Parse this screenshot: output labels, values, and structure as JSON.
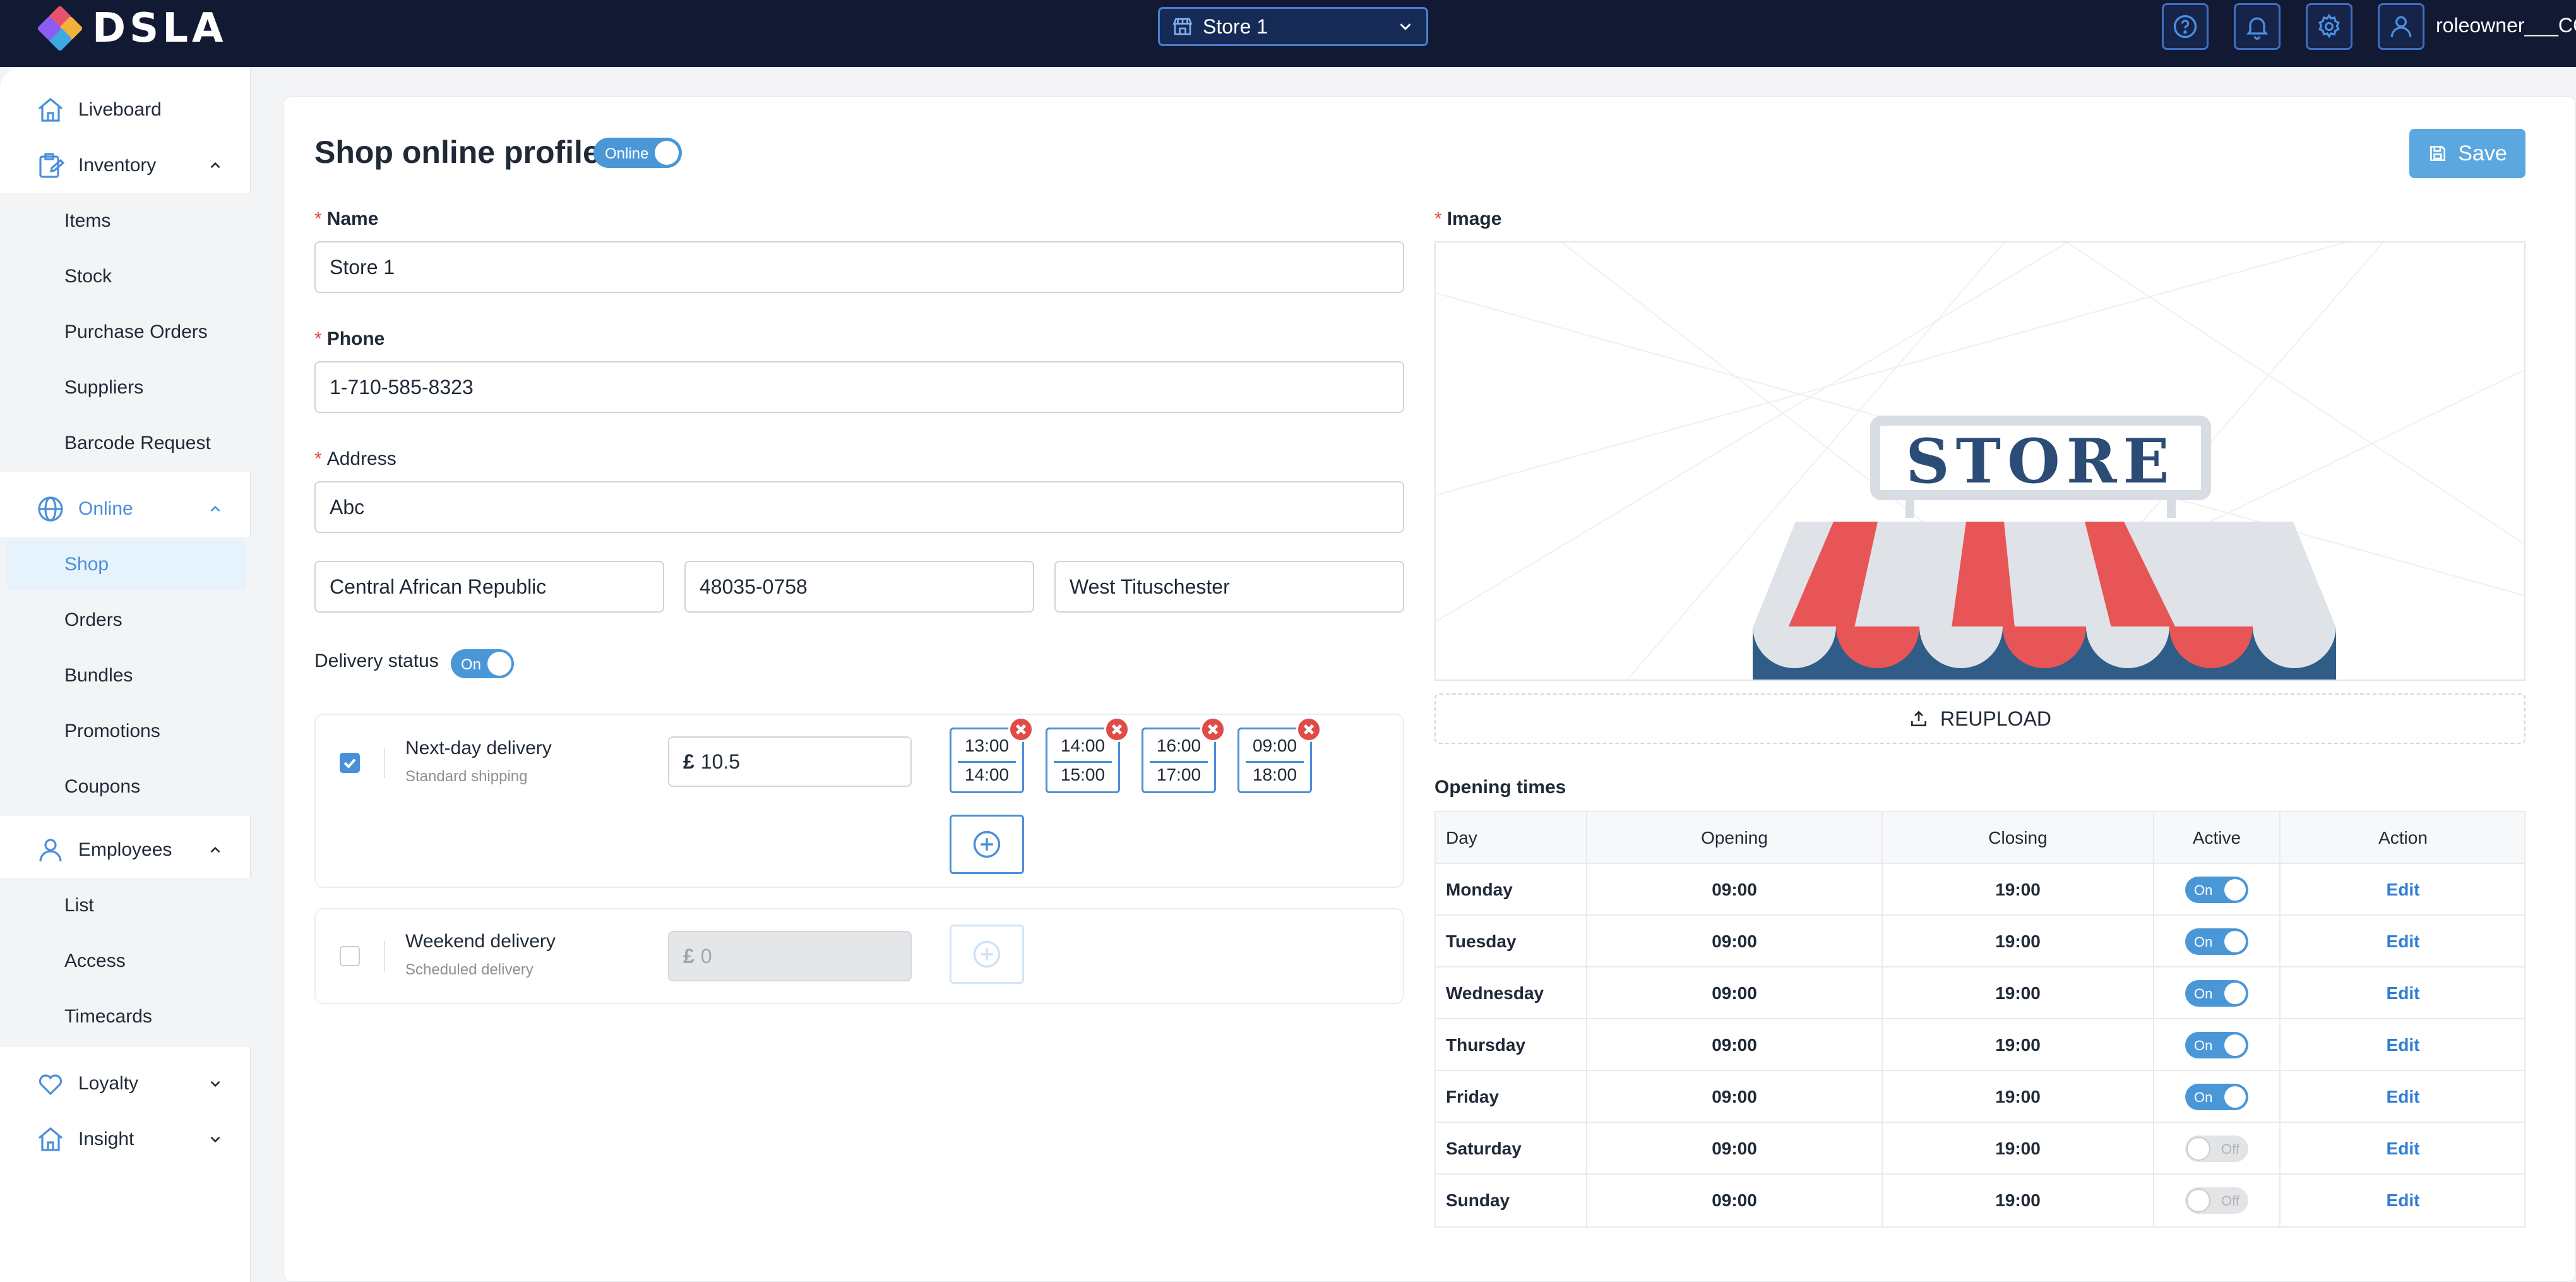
{
  "app": {
    "brand": "DSLA",
    "store_selector": "Store 1",
    "username": "roleowner___CC"
  },
  "colors": {
    "topbar": "#121a33",
    "accent": "#4a90d9",
    "save_button": "#5ca7e0",
    "danger": "#e04a48"
  },
  "icons": {
    "help": "help-icon",
    "notifications": "bell-icon",
    "settings": "gear-icon",
    "user": "user-icon"
  },
  "sidebar": {
    "items": [
      {
        "label": "Liveboard",
        "icon": "home-icon"
      },
      {
        "label": "Inventory",
        "icon": "inventory-icon",
        "expanded": true,
        "children": [
          "Items",
          "Stock",
          "Purchase Orders",
          "Suppliers",
          "Barcode Request"
        ]
      },
      {
        "label": "Online",
        "icon": "globe-icon",
        "expanded": true,
        "children": [
          "Shop",
          "Orders",
          "Bundles",
          "Promotions",
          "Coupons"
        ],
        "active_child": "Shop"
      },
      {
        "label": "Employees",
        "icon": "user-icon",
        "expanded": true,
        "children": [
          "List",
          "Access",
          "Timecards"
        ]
      },
      {
        "label": "Loyalty",
        "icon": "heart-icon",
        "expanded": false
      },
      {
        "label": "Insight",
        "icon": "home-icon",
        "expanded": false
      }
    ]
  },
  "page": {
    "title": "Shop online profile",
    "status_toggle": {
      "label": "Online",
      "on": true
    },
    "save_label": "Save"
  },
  "form": {
    "name_label": "Name",
    "name_value": "Store 1",
    "phone_label": "Phone",
    "phone_value": "1-710-585-8323",
    "address_label": "Address",
    "address_value": "Abc",
    "country_value": "Central African Republic",
    "postcode_value": "48035-0758",
    "city_value": "West Tituschester",
    "delivery_status_label": "Delivery status",
    "delivery_status_toggle": {
      "label": "On",
      "on": true
    }
  },
  "delivery": [
    {
      "title": "Next-day delivery",
      "subtitle": "Standard shipping",
      "checked": true,
      "currency": "£",
      "price": "10.5",
      "slots": [
        {
          "from": "13:00",
          "to": "14:00"
        },
        {
          "from": "14:00",
          "to": "15:00"
        },
        {
          "from": "16:00",
          "to": "17:00"
        },
        {
          "from": "09:00",
          "to": "18:00"
        }
      ]
    },
    {
      "title": "Weekend delivery",
      "subtitle": "Scheduled delivery",
      "checked": false,
      "currency": "£",
      "price": "0",
      "slots": []
    }
  ],
  "image_section": {
    "label": "Image",
    "store_sign_text": "STORE",
    "reupload_label": "REUPLOAD"
  },
  "opening_times": {
    "title": "Opening times",
    "columns": [
      "Day",
      "Opening",
      "Closing",
      "Active",
      "Action"
    ],
    "rows": [
      {
        "day": "Monday",
        "opening": "09:00",
        "closing": "19:00",
        "active": true,
        "active_label": "On",
        "action": "Edit"
      },
      {
        "day": "Tuesday",
        "opening": "09:00",
        "closing": "19:00",
        "active": true,
        "active_label": "On",
        "action": "Edit"
      },
      {
        "day": "Wednesday",
        "opening": "09:00",
        "closing": "19:00",
        "active": true,
        "active_label": "On",
        "action": "Edit"
      },
      {
        "day": "Thursday",
        "opening": "09:00",
        "closing": "19:00",
        "active": true,
        "active_label": "On",
        "action": "Edit"
      },
      {
        "day": "Friday",
        "opening": "09:00",
        "closing": "19:00",
        "active": true,
        "active_label": "On",
        "action": "Edit"
      },
      {
        "day": "Saturday",
        "opening": "09:00",
        "closing": "19:00",
        "active": false,
        "active_label": "Off",
        "action": "Edit"
      },
      {
        "day": "Sunday",
        "opening": "09:00",
        "closing": "19:00",
        "active": false,
        "active_label": "Off",
        "action": "Edit"
      }
    ]
  }
}
